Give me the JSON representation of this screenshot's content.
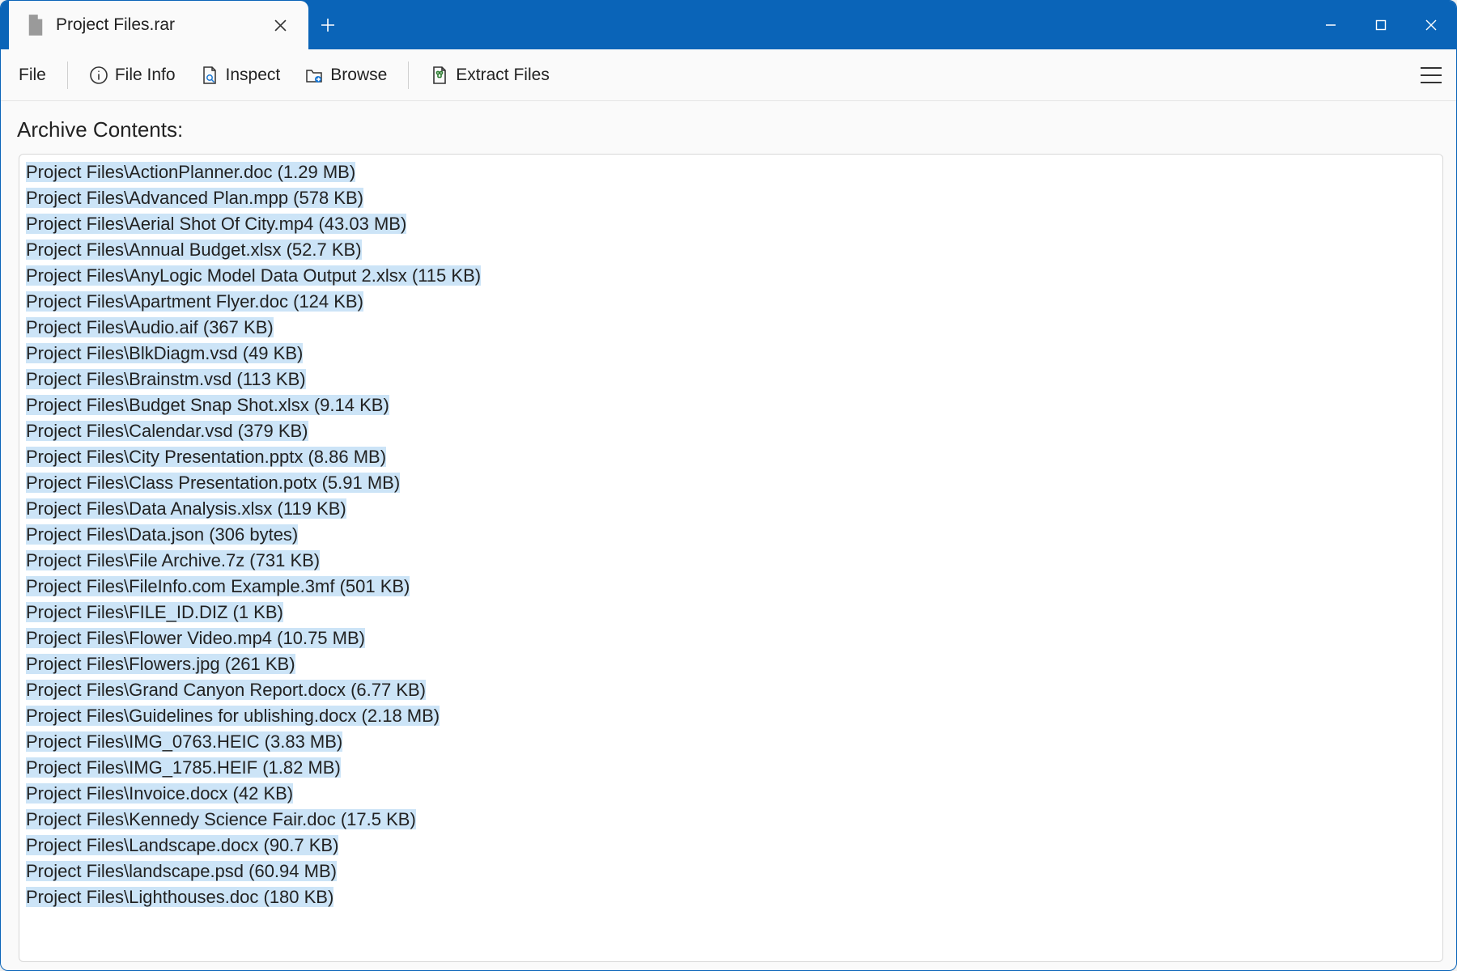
{
  "window": {
    "tab_title": "Project Files.rar"
  },
  "toolbar": {
    "file_label": "File",
    "file_info_label": "File Info",
    "inspect_label": "Inspect",
    "browse_label": "Browse",
    "extract_label": "Extract Files"
  },
  "header": "Archive Contents:",
  "path_prefix": "Project Files\\",
  "files": [
    {
      "name": "ActionPlanner.doc",
      "size": "1.29 MB"
    },
    {
      "name": "Advanced Plan.mpp",
      "size": "578 KB"
    },
    {
      "name": "Aerial Shot Of City.mp4",
      "size": "43.03 MB"
    },
    {
      "name": "Annual Budget.xlsx",
      "size": "52.7 KB"
    },
    {
      "name": "AnyLogic Model Data Output 2.xlsx",
      "size": "115 KB"
    },
    {
      "name": "Apartment Flyer.doc",
      "size": "124 KB"
    },
    {
      "name": "Audio.aif",
      "size": "367 KB"
    },
    {
      "name": "BlkDiagm.vsd",
      "size": "49 KB"
    },
    {
      "name": "Brainstm.vsd",
      "size": "113 KB"
    },
    {
      "name": "Budget Snap Shot.xlsx",
      "size": "9.14 KB"
    },
    {
      "name": "Calendar.vsd",
      "size": "379 KB"
    },
    {
      "name": "City Presentation.pptx",
      "size": "8.86 MB"
    },
    {
      "name": "Class Presentation.potx",
      "size": "5.91 MB"
    },
    {
      "name": "Data Analysis.xlsx",
      "size": "119 KB"
    },
    {
      "name": "Data.json",
      "size": "306 bytes"
    },
    {
      "name": "File Archive.7z",
      "size": "731 KB"
    },
    {
      "name": "FileInfo.com Example.3mf",
      "size": "501 KB"
    },
    {
      "name": "FILE_ID.DIZ",
      "size": "1 KB"
    },
    {
      "name": "Flower Video.mp4",
      "size": "10.75 MB"
    },
    {
      "name": "Flowers.jpg",
      "size": "261 KB"
    },
    {
      "name": "Grand Canyon Report.docx",
      "size": "6.77 KB"
    },
    {
      "name": "Guidelines for ublishing.docx",
      "size": "2.18 MB"
    },
    {
      "name": "IMG_0763.HEIC",
      "size": "3.83 MB"
    },
    {
      "name": "IMG_1785.HEIF",
      "size": "1.82 MB"
    },
    {
      "name": "Invoice.docx",
      "size": "42 KB"
    },
    {
      "name": "Kennedy Science Fair.doc",
      "size": "17.5 KB"
    },
    {
      "name": "Landscape.docx",
      "size": "90.7 KB"
    },
    {
      "name": "landscape.psd",
      "size": "60.94 MB"
    },
    {
      "name": "Lighthouses.doc",
      "size": "180 KB"
    }
  ]
}
